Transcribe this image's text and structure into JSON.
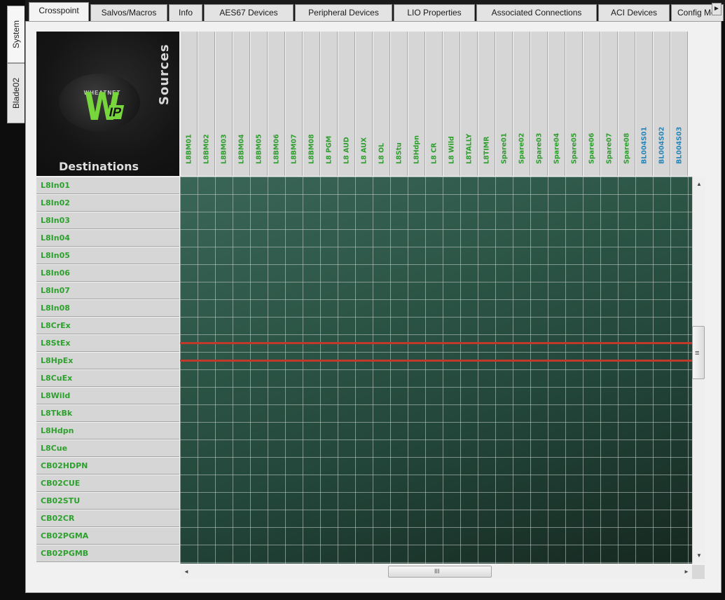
{
  "side_tabs": [
    {
      "label": "System",
      "active": true
    },
    {
      "label": "Blade02",
      "active": false
    }
  ],
  "tabs": [
    {
      "label": "Crosspoint",
      "active": true
    },
    {
      "label": "Salvos/Macros",
      "active": false
    },
    {
      "label": "Info",
      "active": false
    },
    {
      "label": "AES67 Devices",
      "active": false
    },
    {
      "label": "Peripheral Devices",
      "active": false
    },
    {
      "label": "LIO Properties",
      "active": false
    },
    {
      "label": "Associated Connections",
      "active": false
    },
    {
      "label": "ACI Devices",
      "active": false
    },
    {
      "label": "Config Mon",
      "active": false
    }
  ],
  "logo": {
    "brand": "WHEATNET",
    "mark": "W",
    "suffix": "IP"
  },
  "grid_labels": {
    "sources": "Sources",
    "destinations": "Destinations"
  },
  "colors": {
    "source_green": "#2f9e2f",
    "source_blue": "#2a86b8",
    "route_red": "#c0392b",
    "grid_bg": "#2c5546"
  },
  "sources": [
    {
      "label": "L8BM01",
      "color": "green"
    },
    {
      "label": "L8BM02",
      "color": "green"
    },
    {
      "label": "L8BM03",
      "color": "green"
    },
    {
      "label": "L8BM04",
      "color": "green"
    },
    {
      "label": "L8BM05",
      "color": "green"
    },
    {
      "label": "L8BM06",
      "color": "green"
    },
    {
      "label": "L8BM07",
      "color": "green"
    },
    {
      "label": "L8BM08",
      "color": "green"
    },
    {
      "label": "L8 PGM",
      "color": "green"
    },
    {
      "label": "L8 AUD",
      "color": "green"
    },
    {
      "label": "L8 AUX",
      "color": "green"
    },
    {
      "label": "L8 OL",
      "color": "green"
    },
    {
      "label": "L8Stu",
      "color": "green"
    },
    {
      "label": "L8Hdpn",
      "color": "green"
    },
    {
      "label": "L8 CR",
      "color": "green"
    },
    {
      "label": "L8 Wild",
      "color": "green"
    },
    {
      "label": "L8TALLY",
      "color": "green"
    },
    {
      "label": "L8TIMR",
      "color": "green"
    },
    {
      "label": "Spare01",
      "color": "green"
    },
    {
      "label": "Spare02",
      "color": "green"
    },
    {
      "label": "Spare03",
      "color": "green"
    },
    {
      "label": "Spare04",
      "color": "green"
    },
    {
      "label": "Spare05",
      "color": "green"
    },
    {
      "label": "Spare06",
      "color": "green"
    },
    {
      "label": "Spare07",
      "color": "green"
    },
    {
      "label": "Spare08",
      "color": "green"
    },
    {
      "label": "BL004S01",
      "color": "blue"
    },
    {
      "label": "BL004S02",
      "color": "blue"
    },
    {
      "label": "BL004S03",
      "color": "blue"
    }
  ],
  "destinations": [
    {
      "label": "L8In01"
    },
    {
      "label": "L8In02"
    },
    {
      "label": "L8In03"
    },
    {
      "label": "L8In04"
    },
    {
      "label": "L8In05"
    },
    {
      "label": "L8In06"
    },
    {
      "label": "L8In07"
    },
    {
      "label": "L8In08"
    },
    {
      "label": "L8CrEx"
    },
    {
      "label": "L8StEx",
      "highlighted": true
    },
    {
      "label": "L8HpEx",
      "highlighted": true
    },
    {
      "label": "L8CuEx"
    },
    {
      "label": "L8Wild"
    },
    {
      "label": "L8TkBk"
    },
    {
      "label": "L8Hdpn"
    },
    {
      "label": "L8Cue"
    },
    {
      "label": "CB02HDPN"
    },
    {
      "label": "CB02CUE"
    },
    {
      "label": "CB02STU"
    },
    {
      "label": "CB02CR"
    },
    {
      "label": "CB02PGMA"
    },
    {
      "label": "CB02PGMB"
    }
  ],
  "scrollbars": {
    "vertical": {
      "position": 0.38
    },
    "horizontal": {
      "position": 0.41
    },
    "up_glyph": "▲",
    "down_glyph": "▼",
    "left_glyph": "◄",
    "right_glyph": "►",
    "grip_v": "≡",
    "grip_h": "III"
  },
  "tab_scroll_glyph": "►"
}
